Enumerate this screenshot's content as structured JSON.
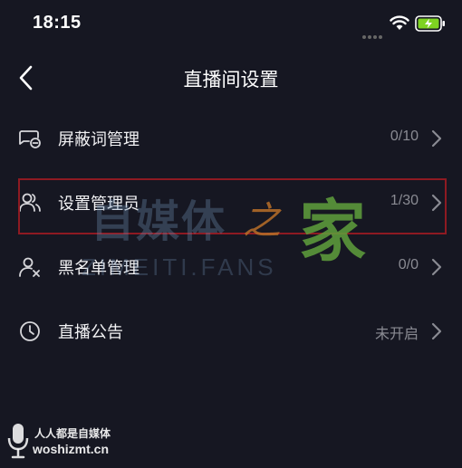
{
  "status_bar": {
    "time": "18:15",
    "icons": [
      "signal-dots-icon",
      "wifi-icon",
      "battery-charging-icon"
    ],
    "battery_color": "#7ed321"
  },
  "nav": {
    "title": "直播间设置",
    "back_icon": "chevron-left-icon"
  },
  "settings": {
    "items": [
      {
        "label": "屏蔽词管理",
        "value": "0/10",
        "icon": "blocked-words-icon"
      },
      {
        "label": "设置管理员",
        "value": "1/30",
        "icon": "admins-icon"
      },
      {
        "label": "黑名单管理",
        "value": "0/0",
        "icon": "blacklist-user-icon"
      },
      {
        "label": "直播公告",
        "value": "未开启",
        "icon": "clock-icon"
      }
    ]
  },
  "highlight": {
    "target": "设置管理员",
    "color": "#8e1a22"
  },
  "watermark": {
    "site": "自媒体",
    "zhi": "之",
    "jia": "家",
    "domain": "ZIMEITI.FANS"
  },
  "footer": {
    "line1": "人人都是自媒体",
    "line2": "woshizmt.cn"
  },
  "colors": {
    "background": "#161722",
    "text_primary": "#f2f2f4",
    "text_secondary": "#8a8b93"
  }
}
